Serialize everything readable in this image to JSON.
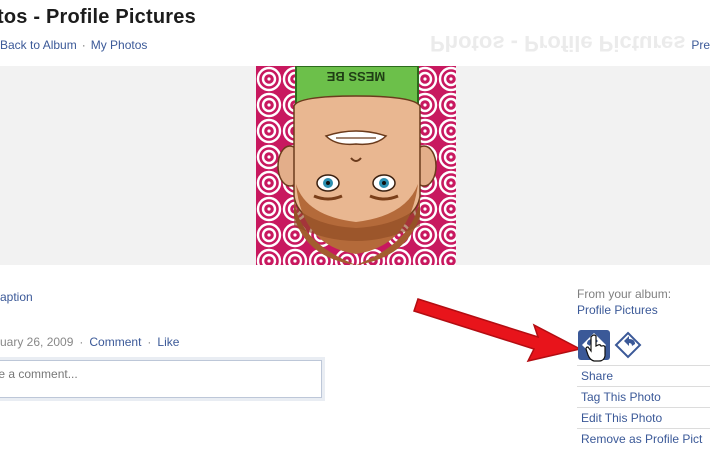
{
  "page": {
    "title": "tos - Profile Pictures",
    "breadcrumb": {
      "back": "Back to Album",
      "separator": "·",
      "my_photos": "My Photos"
    },
    "prev": "Pre"
  },
  "photo": {
    "shirt_text": "MESS BE",
    "bg_color": "#c8185f"
  },
  "caption": {
    "link": "aption"
  },
  "meta": {
    "date": "uary 26, 2009",
    "separator": "·",
    "comment": "Comment",
    "like": "Like"
  },
  "comment_box": {
    "placeholder": "te a comment..."
  },
  "sidebar": {
    "from_label": "From your album:",
    "album": "Profile Pictures",
    "actions": [
      {
        "label": "Share"
      },
      {
        "label": "Tag This Photo"
      },
      {
        "label": "Edit This Photo"
      },
      {
        "label": "Remove as Profile Pict"
      }
    ],
    "icons": [
      "rotate-left-icon",
      "rotate-right-icon",
      "hand-cursor-icon"
    ]
  },
  "annotation": {
    "arrow_color": "#e8141b"
  },
  "colors": {
    "link": "#3b5998",
    "accent": "#3b5998",
    "stage": "#f2f2f2"
  }
}
